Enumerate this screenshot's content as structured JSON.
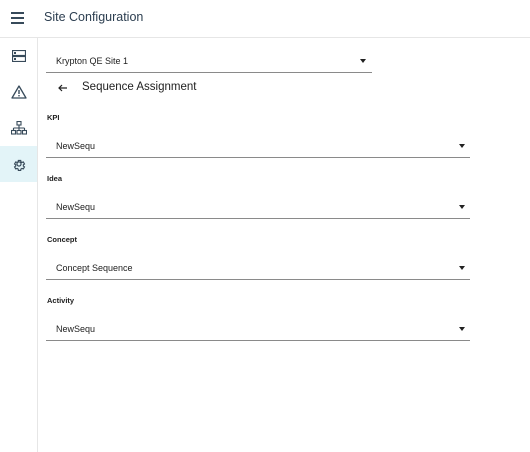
{
  "header": {
    "title": "Site Configuration",
    "menu_icon": "hamburger-menu-icon"
  },
  "rail": {
    "items": [
      {
        "name": "server-icon",
        "active": false
      },
      {
        "name": "warning-icon",
        "active": false
      },
      {
        "name": "hierarchy-icon",
        "active": false
      },
      {
        "name": "gear-icon",
        "active": true
      }
    ]
  },
  "site_select": {
    "value": "Krypton QE Site 1"
  },
  "section": {
    "title": "Sequence Assignment"
  },
  "fields": [
    {
      "label": "KPI",
      "value": "NewSequ"
    },
    {
      "label": "Idea",
      "value": "NewSequ"
    },
    {
      "label": "Concept",
      "value": "Concept Sequence"
    },
    {
      "label": "Activity",
      "value": "NewSequ"
    }
  ],
  "colors": {
    "accent_bg": "#e3f4f8",
    "icon": "#374a5a",
    "underline": "#8a8a8a"
  }
}
